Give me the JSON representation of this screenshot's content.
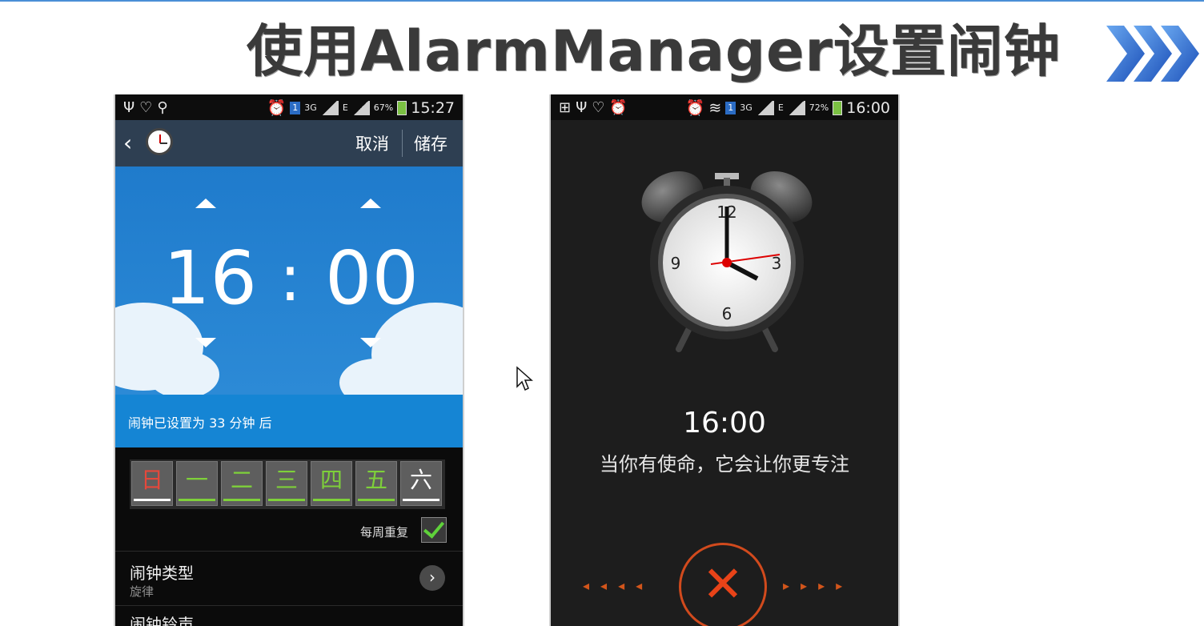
{
  "slide": {
    "title": "使用AlarmManager设置闹钟"
  },
  "phone_left": {
    "status_time": "15:27",
    "network": "3G",
    "network_e": "E",
    "battery": "67%",
    "sim_badge": "1",
    "header": {
      "cancel": "取消",
      "save": "储存"
    },
    "picker": {
      "hour": "16",
      "separator": ":",
      "minute": "00"
    },
    "info": "闹钟已设置为 33 分钟 后",
    "days": [
      {
        "label": "日",
        "color": "#e5483b",
        "underline": "#ffffff"
      },
      {
        "label": "一",
        "color": "#7ed03a",
        "underline": "#7ed03a"
      },
      {
        "label": "二",
        "color": "#7ed03a",
        "underline": "#7ed03a"
      },
      {
        "label": "三",
        "color": "#7ed03a",
        "underline": "#7ed03a"
      },
      {
        "label": "四",
        "color": "#7ed03a",
        "underline": "#7ed03a"
      },
      {
        "label": "五",
        "color": "#7ed03a",
        "underline": "#7ed03a"
      },
      {
        "label": "六",
        "color": "#ffffff",
        "underline": "#ffffff"
      }
    ],
    "repeat_label": "每周重复",
    "repeat_checked": true,
    "rows": [
      {
        "title": "闹钟类型",
        "subtitle": "旋律"
      },
      {
        "title": "闹钟铃声",
        "subtitle": ""
      }
    ]
  },
  "phone_right": {
    "status_time": "16:00",
    "network": "3G",
    "network_e": "E",
    "battery": "72%",
    "sim_badge": "1",
    "clock_numbers": [
      "12",
      "3",
      "6",
      "9"
    ],
    "alarm_time": "16:00",
    "message": "当你有使命，它会让你更专注",
    "accent": "#e84318"
  }
}
